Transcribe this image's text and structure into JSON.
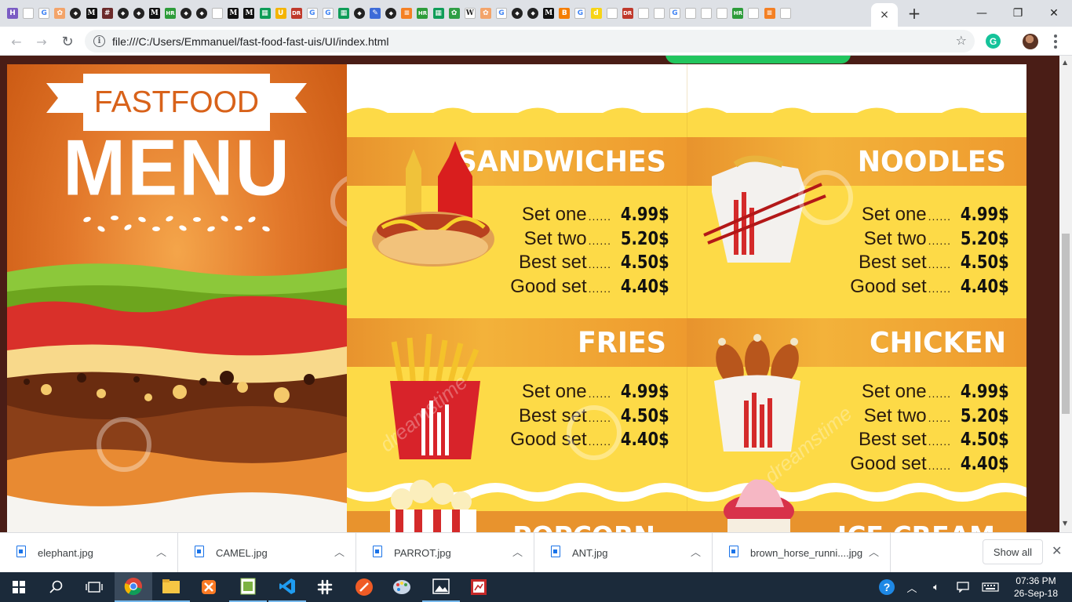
{
  "browser": {
    "tab_favicons": [
      "H",
      "D",
      "G",
      "pinwheel",
      "gh",
      "M",
      "#",
      "gh",
      "gh",
      "M",
      "HR",
      "gh",
      "gh",
      "D",
      "M",
      "M",
      "sheet",
      "U",
      "DR",
      "G",
      "G",
      "sheet",
      "gh",
      "edit",
      "gh",
      "stack",
      "HR",
      "sheet",
      "leaf",
      "W",
      "pinwheel",
      "G",
      "gh",
      "gh",
      "M",
      "B",
      "G",
      "d",
      "D",
      "DR",
      "D",
      "D",
      "G",
      "D",
      "D",
      "D",
      "HR",
      "D",
      "stack",
      "D"
    ],
    "active_tab_close": "×",
    "new_tab": "+",
    "window_controls": {
      "minimize": "—",
      "restore": "❐",
      "close": "✕"
    },
    "nav": {
      "back": "←",
      "forward": "→",
      "reload": "↻"
    },
    "url": "file:///C:/Users/Emmanuel/fast-food-fast-uis/UI/index.html",
    "extension_label": "G"
  },
  "menu": {
    "brand_banner": "FASTFOOD",
    "heading": "MENU",
    "sections": [
      {
        "title": "SANDWICHES",
        "items": [
          {
            "name": "Set one",
            "dots": "......",
            "price": "4.99$"
          },
          {
            "name": "Set two",
            "dots": "......",
            "price": "5.20$"
          },
          {
            "name": "Best set",
            "dots": "......",
            "price": "4.50$"
          },
          {
            "name": "Good set",
            "dots": "......",
            "price": "4.40$"
          }
        ]
      },
      {
        "title": "NOODLES",
        "items": [
          {
            "name": "Set one",
            "dots": "......",
            "price": "4.99$"
          },
          {
            "name": "Set two",
            "dots": "......",
            "price": "5.20$"
          },
          {
            "name": "Best set",
            "dots": "......",
            "price": "4.50$"
          },
          {
            "name": "Good set",
            "dots": "......",
            "price": "4.40$"
          }
        ]
      },
      {
        "title": "FRIES",
        "items": [
          {
            "name": "Set one",
            "dots": "......",
            "price": "4.99$"
          },
          {
            "name": "Best set",
            "dots": "......",
            "price": "4.50$"
          },
          {
            "name": "Good set",
            "dots": "......",
            "price": "4.40$"
          }
        ]
      },
      {
        "title": "CHICKEN",
        "items": [
          {
            "name": "Set one",
            "dots": "......",
            "price": "4.99$"
          },
          {
            "name": "Set two",
            "dots": "......",
            "price": "5.20$"
          },
          {
            "name": "Best set",
            "dots": "......",
            "price": "4.50$"
          },
          {
            "name": "Good set",
            "dots": "......",
            "price": "4.40$"
          }
        ]
      }
    ],
    "lower_sections": [
      "POPCORN",
      "ICE CREAM"
    ],
    "watermark": "dreamstime"
  },
  "downloads": {
    "files": [
      "elephant.jpg",
      "CAMEL.jpg",
      "PARROT.jpg",
      "ANT.jpg",
      "brown_horse_runni....jpg"
    ],
    "show_all": "Show all",
    "close": "✕"
  },
  "taskbar": {
    "time": "07:36 PM",
    "date": "26-Sep-18"
  },
  "colors": {
    "page_background": "#4a1d16",
    "menu_yellow": "#fdda47",
    "band_orange": "#e8932d",
    "chrome_frame": "#dee1e6",
    "taskbar": "#1b2a3a"
  }
}
